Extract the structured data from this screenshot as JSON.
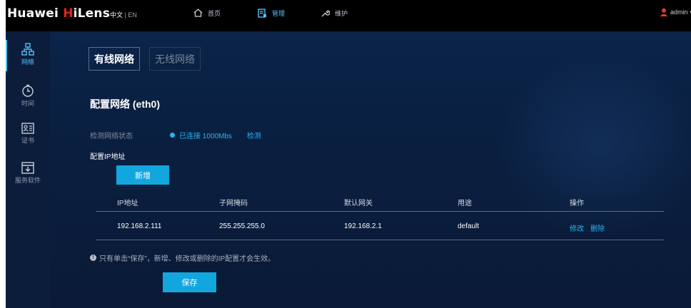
{
  "header": {
    "brand_prefix": "Huawei ",
    "brand_accent": "H",
    "brand_suffix": "iLens",
    "lang_active": "中文",
    "lang_sep": " | ",
    "lang_other": "EN",
    "nav": [
      {
        "label": "首页",
        "icon": "home-icon"
      },
      {
        "label": "管理",
        "icon": "manage-icon",
        "active": true
      },
      {
        "label": "维护",
        "icon": "wrench-icon"
      }
    ],
    "user": {
      "name": "admin",
      "icon": "user-icon",
      "caret": "v"
    }
  },
  "sidebar": {
    "items": [
      {
        "label": "网络",
        "icon": "network-icon",
        "active": true
      },
      {
        "label": "时间",
        "icon": "clock-icon"
      },
      {
        "label": "证书",
        "icon": "certificate-icon"
      },
      {
        "label": "服务软件",
        "icon": "download-box-icon"
      }
    ]
  },
  "tabs": [
    {
      "label": "有线网络",
      "active": true
    },
    {
      "label": "无线网络",
      "active": false
    }
  ],
  "section": {
    "title": "配置网络 (eth0)",
    "status_label": "检测网络状态",
    "status_value": "已连接 1000Mbs",
    "detect_link": "检测",
    "ip_section_label": "配置IP地址",
    "add_button": "新增"
  },
  "table": {
    "headers": [
      "IP地址",
      "子网掩码",
      "默认网关",
      "用途",
      "操作"
    ],
    "rows": [
      {
        "ip": "192.168.2.111",
        "mask": "255.255.255.0",
        "gateway": "192.168.2.1",
        "usage": "default",
        "edit": "修改",
        "delete": "删除"
      }
    ]
  },
  "notice": "只有单击“保存”，新增、修改或删除的IP配置才会生效。",
  "save_button": "保存",
  "colors": {
    "accent": "#12a6df",
    "brand_red": "#e2231a",
    "background": "#0b1a33"
  }
}
